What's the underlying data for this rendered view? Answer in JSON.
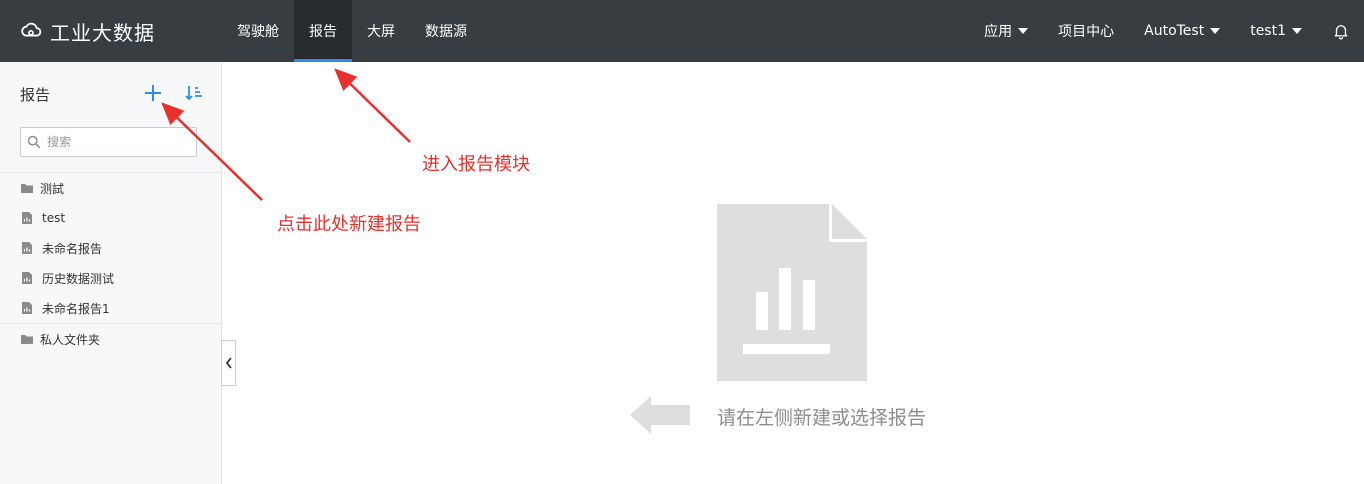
{
  "header": {
    "brand": "工业大数据",
    "nav": [
      {
        "label": "驾驶舱",
        "active": false
      },
      {
        "label": "报告",
        "active": true
      },
      {
        "label": "大屏",
        "active": false
      },
      {
        "label": "数据源",
        "active": false
      }
    ],
    "right": {
      "apps": "应用",
      "project_center": "项目中心",
      "project": "AutoTest",
      "user": "test1"
    }
  },
  "sidebar": {
    "title": "报告",
    "search": {
      "placeholder": "搜索",
      "value": ""
    },
    "items": [
      {
        "label": "测試",
        "type": "folder"
      },
      {
        "label": "test",
        "type": "report"
      },
      {
        "label": "未命名报告",
        "type": "report"
      },
      {
        "label": "历史数据测试",
        "type": "report"
      },
      {
        "label": "未命名报告1",
        "type": "report"
      }
    ],
    "private_folder": {
      "label": "私人文件夹",
      "type": "folder"
    }
  },
  "main": {
    "empty_hint": "请在左侧新建或选择报告"
  },
  "annotations": {
    "enter_module": "进入报告模块",
    "create_here": "点击此处新建报告"
  },
  "colors": {
    "topbar": "#373d41",
    "active_tab_bg": "#272b2e",
    "active_tab_border": "#2d8cf0",
    "accent": "#2d8cf0",
    "annotation": "#e8302c",
    "empty_icon": "#dedede"
  }
}
